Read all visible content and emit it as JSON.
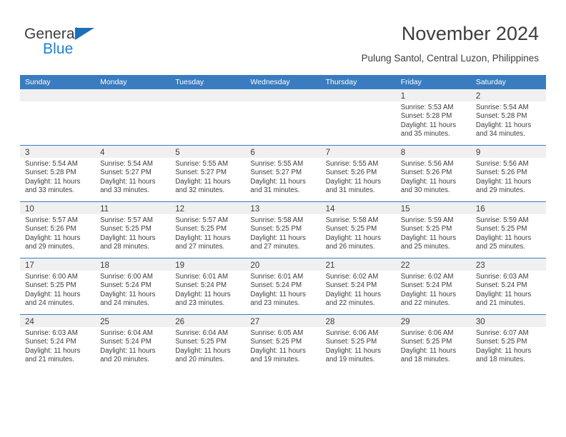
{
  "brand": {
    "name_part1": "General",
    "name_part2": "Blue",
    "triangle_color": "#1c6fb8",
    "blue_color": "#1c7fd6"
  },
  "header": {
    "title": "November 2024",
    "subtitle": "Pulung Santol, Central Luzon, Philippines"
  },
  "theme": {
    "header_blue": "#3a7cc0",
    "daynum_band": "#f0f0f0",
    "text": "#3d3d3d"
  },
  "weekday_headers": [
    "Sunday",
    "Monday",
    "Tuesday",
    "Wednesday",
    "Thursday",
    "Friday",
    "Saturday"
  ],
  "weeks": [
    {
      "days": [
        {
          "num": "",
          "sunrise": "",
          "sunset": "",
          "daylight": "",
          "empty": true
        },
        {
          "num": "",
          "sunrise": "",
          "sunset": "",
          "daylight": "",
          "empty": true
        },
        {
          "num": "",
          "sunrise": "",
          "sunset": "",
          "daylight": "",
          "empty": true
        },
        {
          "num": "",
          "sunrise": "",
          "sunset": "",
          "daylight": "",
          "empty": true
        },
        {
          "num": "",
          "sunrise": "",
          "sunset": "",
          "daylight": "",
          "empty": true
        },
        {
          "num": "1",
          "sunrise": "Sunrise: 5:53 AM",
          "sunset": "Sunset: 5:28 PM",
          "daylight": "Daylight: 11 hours and 35 minutes.",
          "empty": false
        },
        {
          "num": "2",
          "sunrise": "Sunrise: 5:54 AM",
          "sunset": "Sunset: 5:28 PM",
          "daylight": "Daylight: 11 hours and 34 minutes.",
          "empty": false
        }
      ]
    },
    {
      "days": [
        {
          "num": "3",
          "sunrise": "Sunrise: 5:54 AM",
          "sunset": "Sunset: 5:28 PM",
          "daylight": "Daylight: 11 hours and 33 minutes.",
          "empty": false
        },
        {
          "num": "4",
          "sunrise": "Sunrise: 5:54 AM",
          "sunset": "Sunset: 5:27 PM",
          "daylight": "Daylight: 11 hours and 33 minutes.",
          "empty": false
        },
        {
          "num": "5",
          "sunrise": "Sunrise: 5:55 AM",
          "sunset": "Sunset: 5:27 PM",
          "daylight": "Daylight: 11 hours and 32 minutes.",
          "empty": false
        },
        {
          "num": "6",
          "sunrise": "Sunrise: 5:55 AM",
          "sunset": "Sunset: 5:27 PM",
          "daylight": "Daylight: 11 hours and 31 minutes.",
          "empty": false
        },
        {
          "num": "7",
          "sunrise": "Sunrise: 5:55 AM",
          "sunset": "Sunset: 5:26 PM",
          "daylight": "Daylight: 11 hours and 31 minutes.",
          "empty": false
        },
        {
          "num": "8",
          "sunrise": "Sunrise: 5:56 AM",
          "sunset": "Sunset: 5:26 PM",
          "daylight": "Daylight: 11 hours and 30 minutes.",
          "empty": false
        },
        {
          "num": "9",
          "sunrise": "Sunrise: 5:56 AM",
          "sunset": "Sunset: 5:26 PM",
          "daylight": "Daylight: 11 hours and 29 minutes.",
          "empty": false
        }
      ]
    },
    {
      "days": [
        {
          "num": "10",
          "sunrise": "Sunrise: 5:57 AM",
          "sunset": "Sunset: 5:26 PM",
          "daylight": "Daylight: 11 hours and 29 minutes.",
          "empty": false
        },
        {
          "num": "11",
          "sunrise": "Sunrise: 5:57 AM",
          "sunset": "Sunset: 5:25 PM",
          "daylight": "Daylight: 11 hours and 28 minutes.",
          "empty": false
        },
        {
          "num": "12",
          "sunrise": "Sunrise: 5:57 AM",
          "sunset": "Sunset: 5:25 PM",
          "daylight": "Daylight: 11 hours and 27 minutes.",
          "empty": false
        },
        {
          "num": "13",
          "sunrise": "Sunrise: 5:58 AM",
          "sunset": "Sunset: 5:25 PM",
          "daylight": "Daylight: 11 hours and 27 minutes.",
          "empty": false
        },
        {
          "num": "14",
          "sunrise": "Sunrise: 5:58 AM",
          "sunset": "Sunset: 5:25 PM",
          "daylight": "Daylight: 11 hours and 26 minutes.",
          "empty": false
        },
        {
          "num": "15",
          "sunrise": "Sunrise: 5:59 AM",
          "sunset": "Sunset: 5:25 PM",
          "daylight": "Daylight: 11 hours and 25 minutes.",
          "empty": false
        },
        {
          "num": "16",
          "sunrise": "Sunrise: 5:59 AM",
          "sunset": "Sunset: 5:25 PM",
          "daylight": "Daylight: 11 hours and 25 minutes.",
          "empty": false
        }
      ]
    },
    {
      "days": [
        {
          "num": "17",
          "sunrise": "Sunrise: 6:00 AM",
          "sunset": "Sunset: 5:25 PM",
          "daylight": "Daylight: 11 hours and 24 minutes.",
          "empty": false
        },
        {
          "num": "18",
          "sunrise": "Sunrise: 6:00 AM",
          "sunset": "Sunset: 5:24 PM",
          "daylight": "Daylight: 11 hours and 24 minutes.",
          "empty": false
        },
        {
          "num": "19",
          "sunrise": "Sunrise: 6:01 AM",
          "sunset": "Sunset: 5:24 PM",
          "daylight": "Daylight: 11 hours and 23 minutes.",
          "empty": false
        },
        {
          "num": "20",
          "sunrise": "Sunrise: 6:01 AM",
          "sunset": "Sunset: 5:24 PM",
          "daylight": "Daylight: 11 hours and 23 minutes.",
          "empty": false
        },
        {
          "num": "21",
          "sunrise": "Sunrise: 6:02 AM",
          "sunset": "Sunset: 5:24 PM",
          "daylight": "Daylight: 11 hours and 22 minutes.",
          "empty": false
        },
        {
          "num": "22",
          "sunrise": "Sunrise: 6:02 AM",
          "sunset": "Sunset: 5:24 PM",
          "daylight": "Daylight: 11 hours and 22 minutes.",
          "empty": false
        },
        {
          "num": "23",
          "sunrise": "Sunrise: 6:03 AM",
          "sunset": "Sunset: 5:24 PM",
          "daylight": "Daylight: 11 hours and 21 minutes.",
          "empty": false
        }
      ]
    },
    {
      "days": [
        {
          "num": "24",
          "sunrise": "Sunrise: 6:03 AM",
          "sunset": "Sunset: 5:24 PM",
          "daylight": "Daylight: 11 hours and 21 minutes.",
          "empty": false
        },
        {
          "num": "25",
          "sunrise": "Sunrise: 6:04 AM",
          "sunset": "Sunset: 5:24 PM",
          "daylight": "Daylight: 11 hours and 20 minutes.",
          "empty": false
        },
        {
          "num": "26",
          "sunrise": "Sunrise: 6:04 AM",
          "sunset": "Sunset: 5:25 PM",
          "daylight": "Daylight: 11 hours and 20 minutes.",
          "empty": false
        },
        {
          "num": "27",
          "sunrise": "Sunrise: 6:05 AM",
          "sunset": "Sunset: 5:25 PM",
          "daylight": "Daylight: 11 hours and 19 minutes.",
          "empty": false
        },
        {
          "num": "28",
          "sunrise": "Sunrise: 6:06 AM",
          "sunset": "Sunset: 5:25 PM",
          "daylight": "Daylight: 11 hours and 19 minutes.",
          "empty": false
        },
        {
          "num": "29",
          "sunrise": "Sunrise: 6:06 AM",
          "sunset": "Sunset: 5:25 PM",
          "daylight": "Daylight: 11 hours and 18 minutes.",
          "empty": false
        },
        {
          "num": "30",
          "sunrise": "Sunrise: 6:07 AM",
          "sunset": "Sunset: 5:25 PM",
          "daylight": "Daylight: 11 hours and 18 minutes.",
          "empty": false
        }
      ]
    }
  ]
}
